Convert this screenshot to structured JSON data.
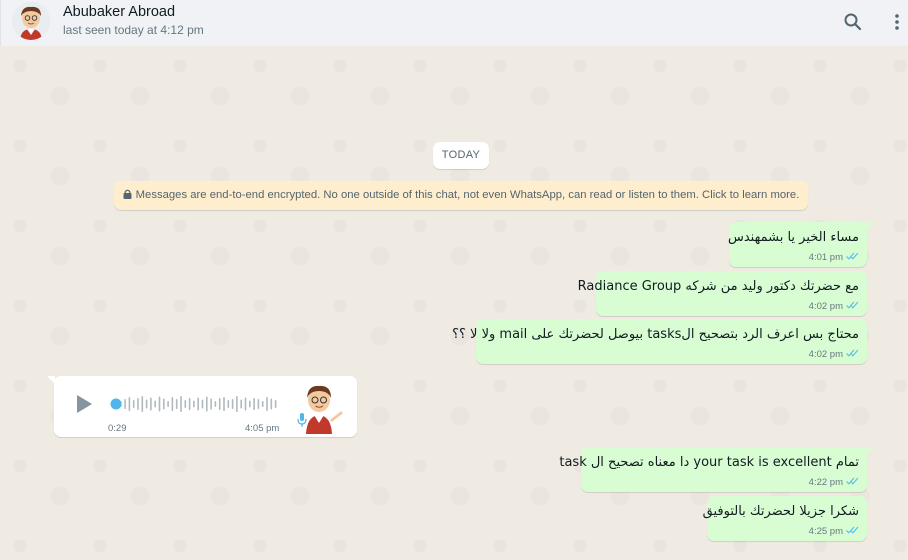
{
  "header": {
    "contact_name": "Abubaker Abroad",
    "status": "last seen today at 4:12 pm",
    "icons": [
      "search-icon",
      "menu-dots-icon"
    ]
  },
  "chat": {
    "date_divider": "TODAY",
    "encryption_notice": "Messages are end-to-end encrypted. No one outside of this chat, not even WhatsApp, can read or listen to them. Click to learn more.",
    "messages": [
      {
        "text": "مساء الخير يا بشمهندس",
        "time": "4:01 pm",
        "status": "read"
      },
      {
        "text": "مع حضرتك دكتور وليد من شركه Radiance Group",
        "time": "4:02 pm",
        "status": "read"
      },
      {
        "text": "محتاج بس اعرف الرد بتصحيح الtasks بيوصل لحضرتك على mail ولا لا ؟؟",
        "time": "4:02 pm",
        "status": "read"
      },
      {
        "text": "تمام  your task is excellent دا معناه تصحيح ال task",
        "time": "4:22 pm",
        "status": "read"
      },
      {
        "text": "شكرا جزيلا لحضرتك بالتوفيق",
        "time": "4:25 pm",
        "status": "read"
      }
    ],
    "voice_message": {
      "duration": "0:29",
      "time": "4:05 pm",
      "progress": 0
    }
  },
  "colors": {
    "outgoing_bubble": "#d9fdd3",
    "incoming_bubble": "#ffffff",
    "chat_background": "#efeae2",
    "read_tick": "#53bdeb",
    "notice_background": "#ffeecd"
  }
}
